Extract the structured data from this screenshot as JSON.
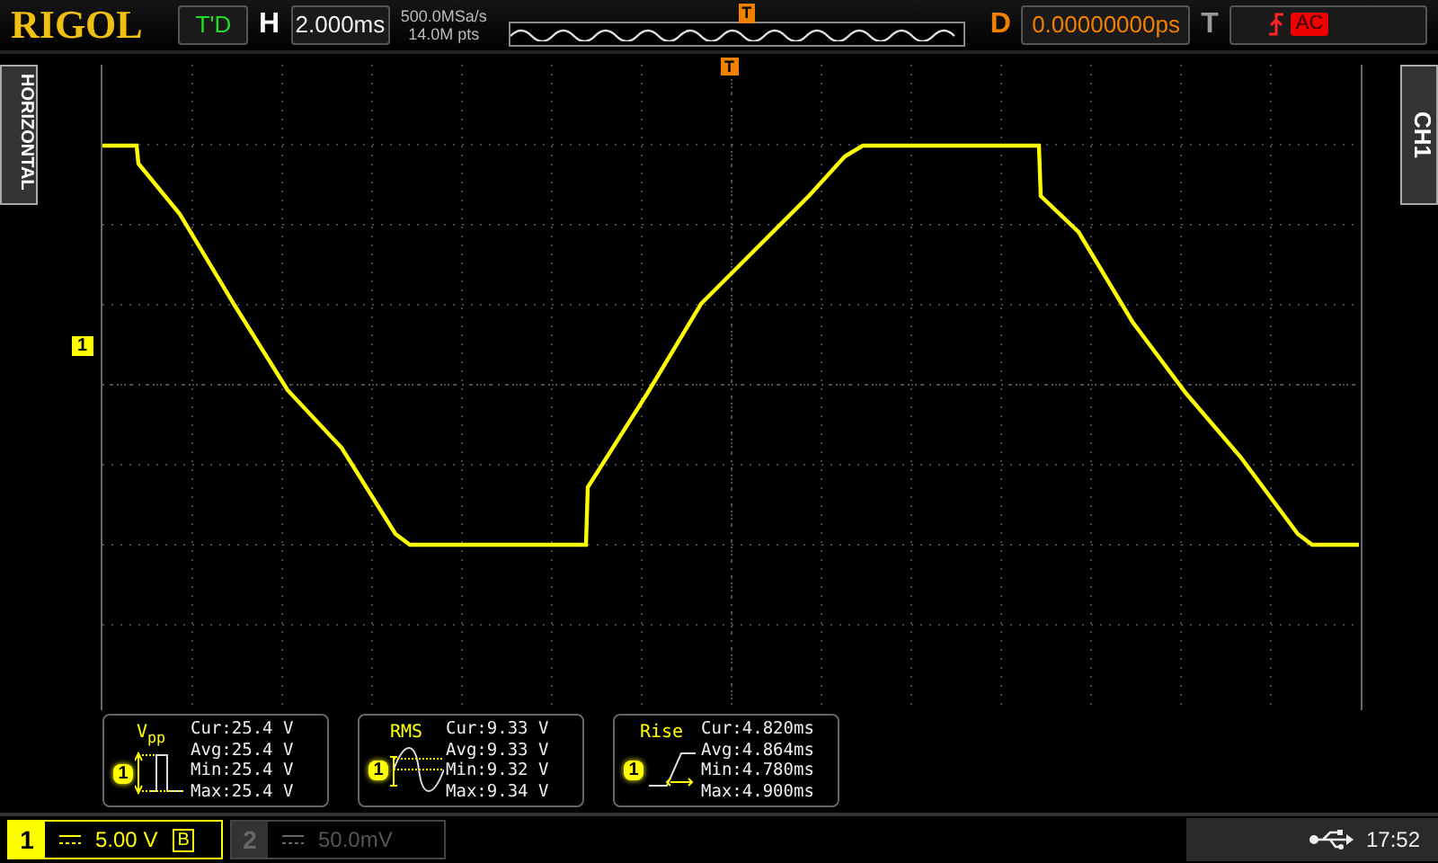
{
  "logo": "RIGOL",
  "status": "T'D",
  "horizontal": {
    "label": "H",
    "timebase": "2.000ms"
  },
  "acquisition": {
    "sample_rate": "500.0MSa/s",
    "memory_depth": "14.0M pts"
  },
  "trigger_position_marker": "T",
  "trigger_time_marker": "T",
  "delay": {
    "label": "D",
    "value": "0.00000000ps"
  },
  "trigger": {
    "label": "T",
    "coupling": "AC"
  },
  "side_tabs": {
    "left": "HORIZONTAL",
    "right": "CH1"
  },
  "channel_level_marker": "1",
  "measurements": [
    {
      "kind": "vpp",
      "title": "V$_{pp}$",
      "source": "1",
      "lines": [
        "Cur:25.4 V",
        "Avg:25.4 V",
        "Min:25.4 V",
        "Max:25.4 V"
      ]
    },
    {
      "kind": "rms",
      "title": "RMS",
      "source": "1",
      "lines": [
        "Cur:9.33 V",
        "Avg:9.33 V",
        "Min:9.32 V",
        "Max:9.34 V"
      ]
    },
    {
      "kind": "rise",
      "title": "Rise",
      "source": "1",
      "lines": [
        "Cur:4.820ms",
        "Avg:4.864ms",
        "Min:4.780ms",
        "Max:4.900ms"
      ]
    }
  ],
  "channels": [
    {
      "number": "1",
      "scale": "5.00 V",
      "bandwidth_limit": "B",
      "on": true
    },
    {
      "number": "2",
      "scale": "50.0mV",
      "on": false
    }
  ],
  "clock": "17:52"
}
